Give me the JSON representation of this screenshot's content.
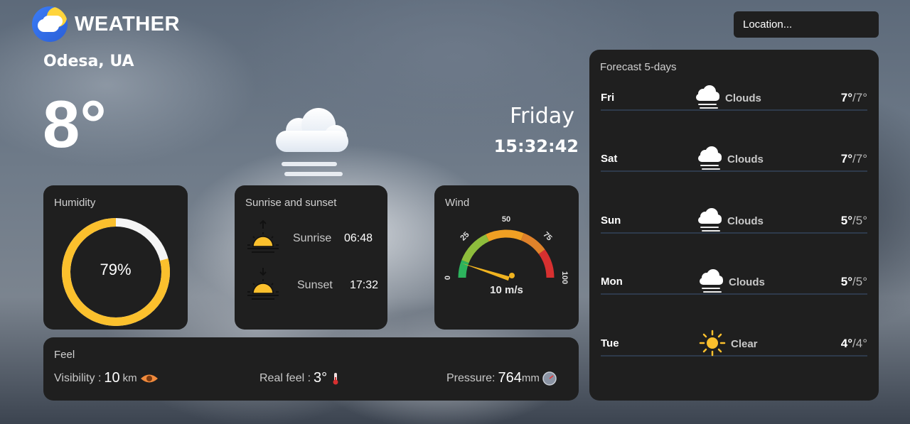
{
  "app": {
    "title": "WEATHER"
  },
  "search": {
    "placeholder": "Location..."
  },
  "current": {
    "city": "Odesa, UA",
    "temperature": "8°",
    "condition_icon": "clouds-fog-icon",
    "day": "Friday",
    "time": "15:32:42"
  },
  "humidity": {
    "title": "Humidity",
    "value_text": "79%",
    "value": 79
  },
  "sun": {
    "title": "Sunrise and sunset",
    "sunrise_label": "Sunrise",
    "sunrise_time": "06:48",
    "sunset_label": "Sunset",
    "sunset_time": "17:32"
  },
  "wind": {
    "title": "Wind",
    "speed_text": "10 m/s",
    "speed": 10,
    "scale_labels": [
      "0",
      "25",
      "50",
      "75",
      "100"
    ],
    "segment_colors": [
      "#2db35d",
      "#8ebd3c",
      "#f0a023",
      "#e0822a",
      "#d73030"
    ]
  },
  "feel": {
    "title": "Feel",
    "visibility_label": "Visibility :",
    "visibility_value": "10",
    "visibility_unit": "km",
    "realfeel_label": "Real feel :",
    "realfeel_value": "3°",
    "pressure_label": "Pressure:",
    "pressure_value": "764",
    "pressure_unit": "mm"
  },
  "forecast": {
    "title": "Forecast 5-days",
    "days": [
      {
        "day": "Fri",
        "condition": "Clouds",
        "hi": "7°",
        "lo": "/7°",
        "icon": "clouds-fog-icon"
      },
      {
        "day": "Sat",
        "condition": "Clouds",
        "hi": "7°",
        "lo": "/7°",
        "icon": "clouds-fog-icon"
      },
      {
        "day": "Sun",
        "condition": "Clouds",
        "hi": "5°",
        "lo": "/5°",
        "icon": "clouds-fog-icon"
      },
      {
        "day": "Mon",
        "condition": "Clouds",
        "hi": "5°",
        "lo": "/5°",
        "icon": "clouds-fog-icon"
      },
      {
        "day": "Tue",
        "condition": "Clear",
        "hi": "4°",
        "lo": "/4°",
        "icon": "sun-icon"
      }
    ]
  },
  "colors": {
    "card_bg": "#1f1f1f",
    "accent": "#fbc02d",
    "divider": "#2e3a4b"
  }
}
